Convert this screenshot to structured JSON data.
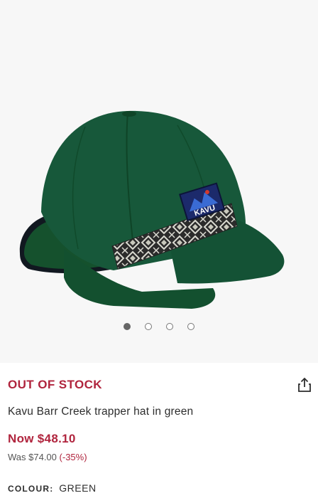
{
  "gallery": {
    "image_icon": "green-fleece-trapper-cap-image",
    "dot_count": 4,
    "active_index": 0
  },
  "product": {
    "stock_status": "OUT OF STOCK",
    "name": "Kavu Barr Creek trapper hat in green",
    "now_price": "Now $48.10",
    "was_price": "Was $74.00",
    "discount": "(-35%)",
    "colour_label": "COLOUR:",
    "colour_value": "GREEN",
    "badge_text": "KAVU"
  },
  "share_icon": "share-icon",
  "colors": {
    "sale_red": "#b0243d",
    "cap_green": "#14532e",
    "background": "#f7f7f7"
  }
}
